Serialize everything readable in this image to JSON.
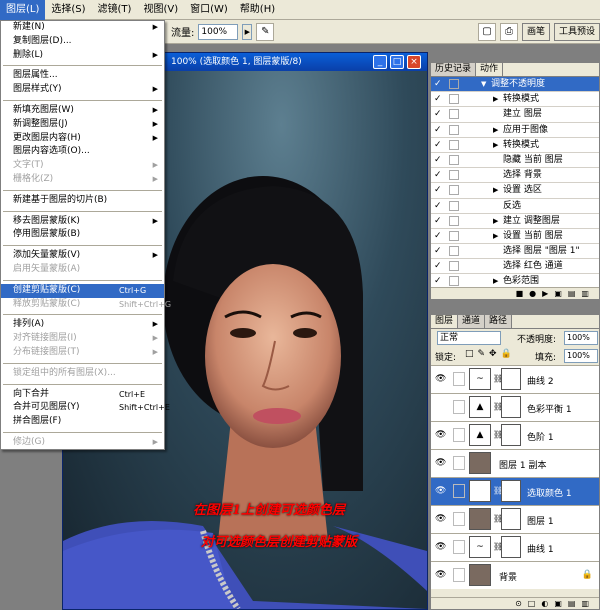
{
  "menubar": {
    "items": [
      {
        "label": "图层(L)",
        "active": true
      },
      {
        "label": "选择(S)"
      },
      {
        "label": "滤镜(T)"
      },
      {
        "label": "视图(V)"
      },
      {
        "label": "窗口(W)"
      },
      {
        "label": "帮助(H)"
      }
    ]
  },
  "options_bar": {
    "flow_label": "流量:",
    "flow_value": "100%",
    "tab_brushes": "画笔",
    "tab_presets": "工具预设"
  },
  "layer_menu": {
    "items": [
      {
        "label": "新建(N)",
        "submenu": true
      },
      {
        "label": "复制图层(D)..."
      },
      {
        "label": "删除(L)",
        "submenu": true
      },
      {
        "sep": true
      },
      {
        "label": "图层属性..."
      },
      {
        "label": "图层样式(Y)",
        "submenu": true
      },
      {
        "sep": true
      },
      {
        "label": "新填充图层(W)",
        "submenu": true
      },
      {
        "label": "新调整图层(J)",
        "submenu": true
      },
      {
        "label": "更改图层内容(H)",
        "submenu": true
      },
      {
        "label": "图层内容选项(O)..."
      },
      {
        "label": "文字(T)",
        "submenu": true,
        "disabled": true
      },
      {
        "label": "栅格化(Z)",
        "submenu": true,
        "disabled": true
      },
      {
        "sep": true
      },
      {
        "label": "新建基于图层的切片(B)"
      },
      {
        "sep": true
      },
      {
        "label": "移去图层蒙版(K)",
        "submenu": true
      },
      {
        "label": "停用图层蒙版(B)"
      },
      {
        "sep": true
      },
      {
        "label": "添加矢量蒙版(V)",
        "submenu": true
      },
      {
        "label": "启用矢量蒙版(A)",
        "disabled": true
      },
      {
        "sep": true
      },
      {
        "label": "创建剪贴蒙版(C)",
        "shortcut": "Ctrl+G",
        "highlighted": true
      },
      {
        "label": "释放剪贴蒙版(C)",
        "shortcut": "Shift+Ctrl+G",
        "disabled": true
      },
      {
        "sep": true
      },
      {
        "label": "排列(A)",
        "submenu": true
      },
      {
        "label": "对齐链接图层(I)",
        "submenu": true,
        "disabled": true
      },
      {
        "label": "分布链接图层(T)",
        "submenu": true,
        "disabled": true
      },
      {
        "sep": true
      },
      {
        "label": "锁定组中的所有图层(X)...",
        "disabled": true
      },
      {
        "sep": true
      },
      {
        "label": "向下合并",
        "shortcut": "Ctrl+E"
      },
      {
        "label": "合并可见图层(Y)",
        "shortcut": "Shift+Ctrl+E"
      },
      {
        "label": "拼合图层(F)"
      },
      {
        "sep": true
      },
      {
        "label": "修边(G)",
        "submenu": true,
        "disabled": true
      }
    ]
  },
  "document": {
    "title": "100% (选取颜色 1, 图层蒙版/8)"
  },
  "captions": {
    "line1": "在图层1上创建可选颜色层",
    "line2": "对可选颜色层创建剪贴蒙版"
  },
  "actions_panel": {
    "tabs": [
      "历史记录",
      "动作"
    ],
    "rows": [
      {
        "label": "调整不透明度",
        "expanded": true,
        "selected": true
      },
      {
        "label": "转换模式",
        "arrow": true
      },
      {
        "label": "建立 图层"
      },
      {
        "label": "应用于图像",
        "arrow": true
      },
      {
        "label": "转换模式",
        "arrow": true
      },
      {
        "label": "隐藏 当前 图层"
      },
      {
        "label": "选择 背景"
      },
      {
        "label": "设置 选区",
        "arrow": true
      },
      {
        "label": "反选"
      },
      {
        "label": "建立 调整图层",
        "arrow": true
      },
      {
        "label": "设置 当前 图层",
        "arrow": true
      },
      {
        "label": "选择 图层 \"图层 1\""
      },
      {
        "label": "选择 红色 通道"
      },
      {
        "label": "色彩范围",
        "arrow": true
      }
    ]
  },
  "layers_panel": {
    "tabs": [
      "图层",
      "通道",
      "路径"
    ],
    "blend_mode": "正常",
    "opacity_label": "不透明度:",
    "opacity_value": "100%",
    "lock_label": "锁定:",
    "fill_label": "填充:",
    "fill_value": "100%",
    "layers": [
      {
        "name": "曲线 2",
        "thumb": "~",
        "visible": true
      },
      {
        "name": "色彩平衡 1",
        "thumb": "▲",
        "visible": false
      },
      {
        "name": "色阶 1",
        "thumb": "▲",
        "visible": true
      },
      {
        "name": "图层 1 副本",
        "thumb": "img",
        "visible": true,
        "no_mask": true
      },
      {
        "name": "选取颜色 1",
        "thumb": "◐",
        "visible": true,
        "selected": true
      },
      {
        "name": "图层 1",
        "thumb": "img",
        "visible": true
      },
      {
        "name": "曲线 1",
        "thumb": "~",
        "visible": true
      },
      {
        "name": "背景",
        "thumb": "img",
        "visible": true,
        "no_mask": true,
        "locked": true
      }
    ]
  },
  "colors": {
    "menu_highlight": "#316ac5",
    "caption": "#ff0000"
  }
}
